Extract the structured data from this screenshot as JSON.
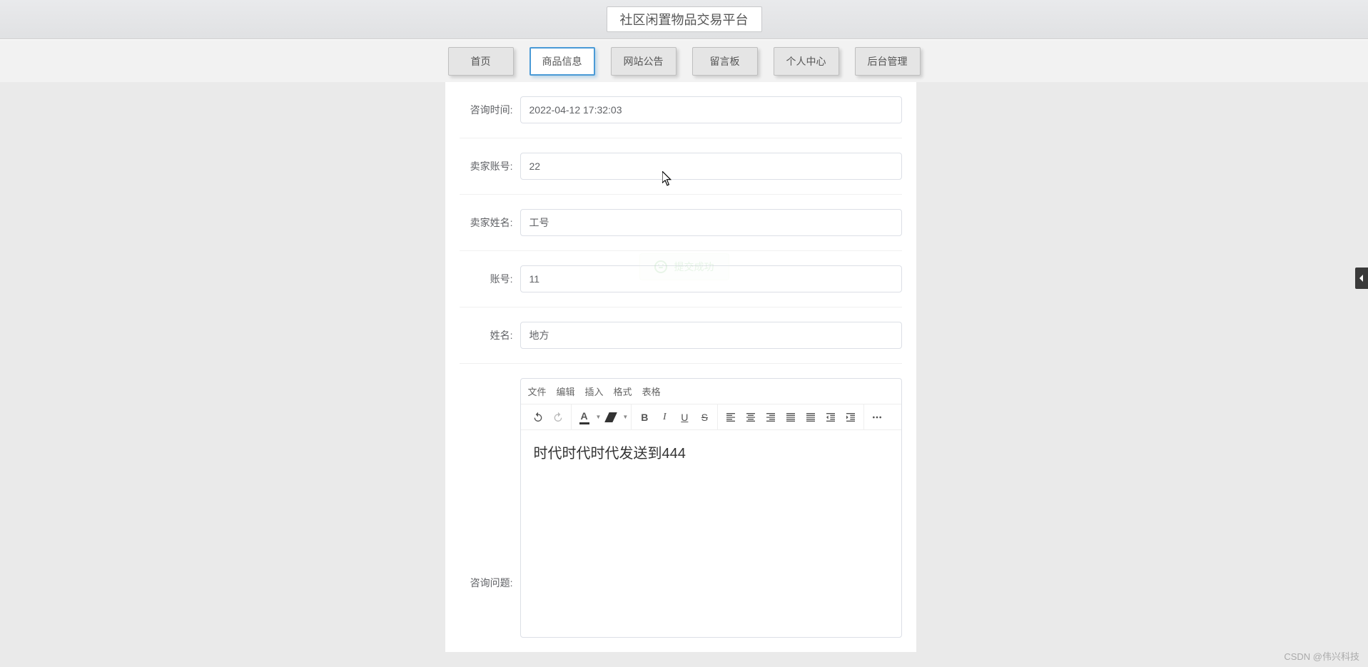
{
  "app": {
    "title": "社区闲置物品交易平台"
  },
  "nav": {
    "items": [
      {
        "label": "首页",
        "active": false
      },
      {
        "label": "商品信息",
        "active": true
      },
      {
        "label": "网站公告",
        "active": false
      },
      {
        "label": "留言板",
        "active": false
      },
      {
        "label": "个人中心",
        "active": false
      },
      {
        "label": "后台管理",
        "active": false
      }
    ]
  },
  "form": {
    "consult_time_label": "咨询时间:",
    "consult_time_value": "2022-04-12 17:32:03",
    "seller_account_label": "卖家账号:",
    "seller_account_value": "22",
    "seller_name_label": "卖家姓名:",
    "seller_name_value": "工号",
    "account_label": "账号:",
    "account_value": "11",
    "name_label": "姓名:",
    "name_value": "地方",
    "consult_question_label": "咨询问题:"
  },
  "editor": {
    "menubar": {
      "file": "文件",
      "edit": "编辑",
      "insert": "插入",
      "format": "格式",
      "table": "表格"
    },
    "content": "时代时代时代发送到444"
  },
  "toast": {
    "message": "提交成功"
  },
  "watermark": "CSDN @伟兴科技"
}
